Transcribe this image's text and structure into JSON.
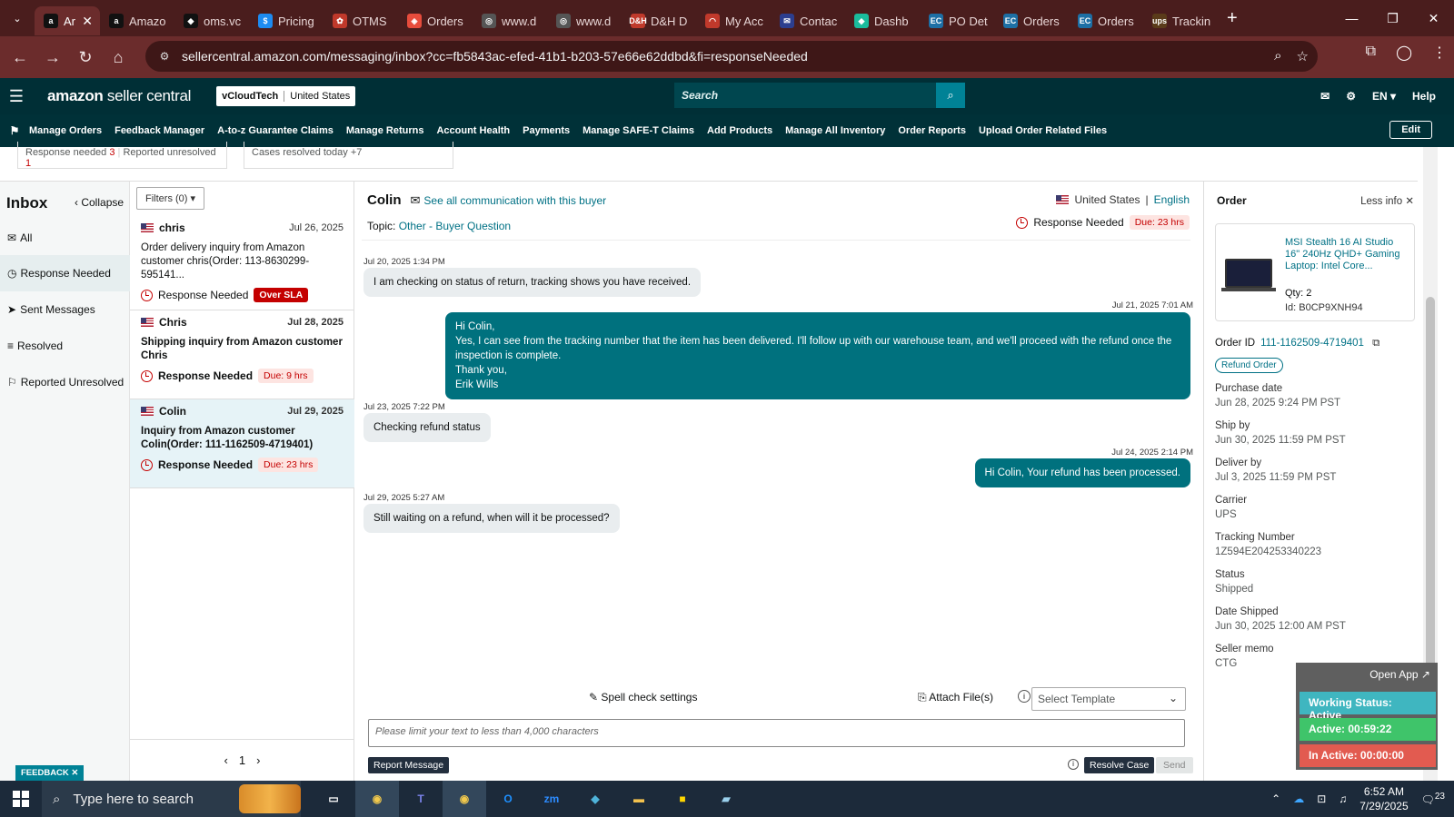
{
  "browser": {
    "tabs": [
      {
        "label": "Ar",
        "fav": "a",
        "color": "#111111",
        "active": true
      },
      {
        "label": "Amazo",
        "fav": "a",
        "color": "#111111"
      },
      {
        "label": "oms.vc",
        "fav": "◆",
        "color": "#111111"
      },
      {
        "label": "Pricing",
        "fav": "$",
        "color": "#1d8bf1"
      },
      {
        "label": "OTMS",
        "fav": "✿",
        "color": "#c0392b"
      },
      {
        "label": "Orders",
        "fav": "◈",
        "color": "#e74c3c"
      },
      {
        "label": "www.d",
        "fav": "◎",
        "color": "#555555"
      },
      {
        "label": "www.d",
        "fav": "◎",
        "color": "#555555"
      },
      {
        "label": "D&H D",
        "fav": "D&H",
        "color": "#c0392b"
      },
      {
        "label": "My Acc",
        "fav": "◠",
        "color": "#c0392b"
      },
      {
        "label": "Contac",
        "fav": "✉",
        "color": "#2c3e8f"
      },
      {
        "label": "Dashb",
        "fav": "◆",
        "color": "#1abc9c"
      },
      {
        "label": "PO Det",
        "fav": "EC",
        "color": "#1d6fa5"
      },
      {
        "label": "Orders",
        "fav": "EC",
        "color": "#1d6fa5"
      },
      {
        "label": "Orders",
        "fav": "EC",
        "color": "#1d6fa5"
      },
      {
        "label": "Trackin",
        "fav": "ups",
        "color": "#5a3b1a"
      }
    ],
    "url": "sellercentral.amazon.com/messaging/inbox?cc=fb5843ac-efed-41b1-b203-57e66e62ddbd&fi=responseNeeded"
  },
  "header": {
    "logo_main": "amazon",
    "logo_sub": " seller central",
    "account_name": "vCloudTech",
    "account_region": "United States",
    "search_placeholder": "Search",
    "lang": "EN",
    "help": "Help"
  },
  "nav": {
    "items": [
      "Manage Orders",
      "Feedback Manager",
      "A-to-z Guarantee Claims",
      "Manage Returns",
      "Account Health",
      "Payments",
      "Manage SAFE-T Claims",
      "Add Products",
      "Manage All Inventory",
      "Order Reports",
      "Upload Order Related Files"
    ],
    "edit": "Edit"
  },
  "stats": {
    "response_needed_label": "Response needed",
    "response_needed_count": "3",
    "reported_unresolved_label": "Reported unresolved",
    "reported_unresolved_count": "1",
    "cases_resolved_label": "Cases resolved today",
    "cases_resolved_count": "+7"
  },
  "inbox": {
    "title": "Inbox",
    "collapse": "Collapse",
    "items": [
      "All",
      "Response Needed",
      "Sent Messages",
      "Resolved",
      "Reported Unresolved"
    ]
  },
  "filters": "Filters (0)",
  "conversations": [
    {
      "name": "chris",
      "date": "Jul 26, 2025",
      "subject": "Order delivery inquiry from Amazon customer chris(Order: 113-8630299-595141...",
      "status": "Response Needed",
      "badge": "Over SLA"
    },
    {
      "name": "Chris",
      "date": "Jul 28, 2025",
      "subject": "Shipping inquiry from Amazon customer Chris",
      "status": "Response Needed",
      "badge": "Due: 9 hrs"
    },
    {
      "name": "Colin",
      "date": "Jul 29, 2025",
      "subject": "Inquiry from Amazon customer Colin(Order: 111-1162509-4719401)",
      "status": "Response Needed",
      "badge": "Due: 23 hrs"
    }
  ],
  "pager": {
    "page": "1"
  },
  "thread": {
    "buyer": "Colin",
    "see_all": "See all communication with this buyer",
    "topic_label": "Topic:",
    "topic": "Other - Buyer Question",
    "country": "United States",
    "language": "English",
    "status": "Response Needed",
    "due": "Due: 23 hrs",
    "messages": [
      {
        "time": "Jul 20, 2025 1:34 PM",
        "text": "I am checking on status of return, tracking shows you have received."
      },
      {
        "time": "Jul 21, 2025 7:01 AM",
        "lines": [
          "Hi Colin,",
          "Yes, I can see from the tracking number that the item has been delivered. I'll follow up with our warehouse team, and we'll proceed with the refund once the inspection is complete.",
          "Thank you,",
          "Erik Wills"
        ]
      },
      {
        "time": "Jul 23, 2025 7:22 PM",
        "text": "Checking refund status"
      },
      {
        "time": "Jul 24, 2025 2:14 PM",
        "text": "Hi Colin, Your refund has been processed."
      },
      {
        "time": "Jul 29, 2025 5:27 AM",
        "text": "Still waiting on a refund, when will it be processed?"
      }
    ],
    "spell_check": "Spell check settings",
    "attach": "Attach File(s)",
    "template_placeholder": "Select Template",
    "compose_placeholder": "Please limit your text to less than 4,000 characters",
    "report": "Report Message",
    "resolve": "Resolve Case",
    "send": "Send"
  },
  "order": {
    "title": "Order",
    "less_info": "Less info",
    "product": "MSI Stealth 16 AI Studio 16\" 240Hz QHD+ Gaming Laptop: Intel Core...",
    "qty": "Qty: 2",
    "asin": "Id: B0CP9XNH94",
    "order_id_label": "Order ID",
    "order_id": "111-1162509-4719401",
    "refund": "Refund Order",
    "fields": [
      {
        "k": "Purchase date",
        "v": "Jun 28, 2025 9:24 PM PST"
      },
      {
        "k": "Ship by",
        "v": "Jun 30, 2025 11:59 PM PST"
      },
      {
        "k": "Deliver by",
        "v": "Jul 3, 2025 11:59 PM PST"
      },
      {
        "k": "Carrier",
        "v": "UPS"
      },
      {
        "k": "Tracking Number",
        "v": "1Z594E204253340223"
      },
      {
        "k": "Status",
        "v": "Shipped"
      },
      {
        "k": "Date Shipped",
        "v": "Jun 30, 2025 12:00 AM PST"
      },
      {
        "k": "Seller memo",
        "v": "CTG"
      }
    ]
  },
  "overlay": {
    "open_app": "Open App ↗",
    "working": "Working Status: Active",
    "active": "Active: 00:59:22",
    "inactive": "In Active: 00:00:00"
  },
  "feedback": "FEEDBACK",
  "taskbar": {
    "search": "Type here to search",
    "time": "6:52 AM",
    "date": "7/29/2025",
    "notif": "23"
  }
}
